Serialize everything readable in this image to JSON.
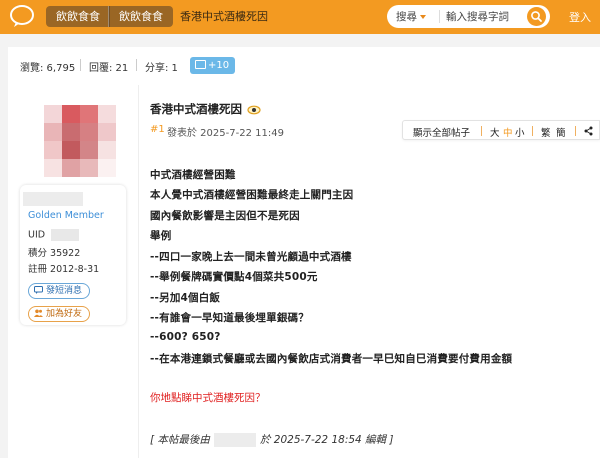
{
  "header": {
    "breadcrumbs": [
      "飲飲食食",
      "飲飲食食",
      "香港中式酒樓死因"
    ],
    "search": {
      "type_label": "搜尋",
      "placeholder": "輸入搜尋字詞"
    },
    "login_label": "登入",
    "accent_color": "#f39a21"
  },
  "stats": {
    "views": "瀏覽: 6,795",
    "replies": "回覆: 21",
    "shares": "分享: 1",
    "images_badge": "+10"
  },
  "author": {
    "rank": "Golden Member",
    "uid_label": "UID",
    "points": "積分  35922",
    "registered": "註冊  2012-8-31",
    "pm_label": "發短消息",
    "friend_label": "加為好友"
  },
  "post": {
    "title": "香港中式酒樓死因",
    "floor": "#1",
    "posted": "發表於 2025-7-22 11:49",
    "options": {
      "show_all": "顯示全部帖子",
      "size_big": "大",
      "size_mid": "中",
      "size_small": "小",
      "trad": "繁",
      "simp": "簡"
    },
    "lines": [
      "中式酒樓經營困難",
      "本人覺中式酒樓經營困難最終走上關門主因",
      "國內餐飲影響是主因但不是死因",
      "舉例",
      "--四口一家晚上去一間未曾光顧過中式酒樓",
      "--舉例餐牌碼實價點4個菜共500元",
      "--另加4個白飯",
      "--有誰會一早知道最後埋單銀碼？",
      "--600?   650?",
      "--在本港連鎖式餐廳或去國內餐飲店式消費者一早巳知自巳消費要付費用金額"
    ],
    "question": "你地點睇中式酒樓死因？",
    "edit_prefix": "[   本帖最後由",
    "edit_suffix": "於   2025-7-22   18:54   編輯   ]"
  }
}
